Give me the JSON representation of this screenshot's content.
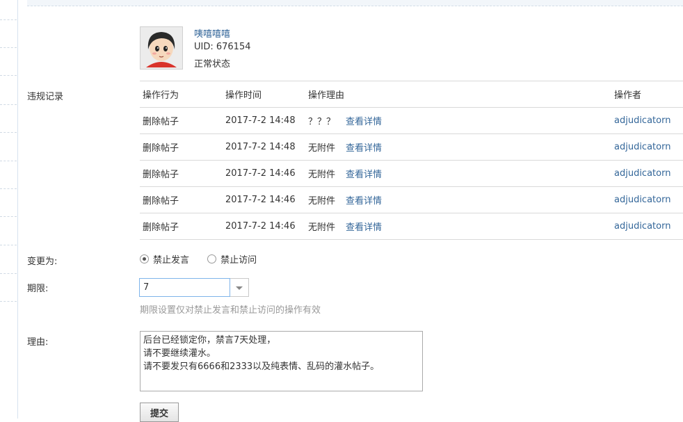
{
  "user": {
    "name": "咦嘻嘻嘻",
    "uid": "UID: 676154",
    "status": "正常状态"
  },
  "labels": {
    "records": "违规记录",
    "change_to": "变更为:",
    "period": "期限:",
    "reason": "理由:"
  },
  "records": {
    "headers": [
      "操作行为",
      "操作时间",
      "操作理由",
      "操作者"
    ],
    "detail_label": "查看详情",
    "rows": [
      {
        "action": "删除帖子",
        "time": "2017-7-2 14:48",
        "reason": "？？？",
        "operator": "adjudicatorn"
      },
      {
        "action": "删除帖子",
        "time": "2017-7-2 14:48",
        "reason": "无附件",
        "operator": "adjudicatorn"
      },
      {
        "action": "删除帖子",
        "time": "2017-7-2 14:46",
        "reason": "无附件",
        "operator": "adjudicatorn"
      },
      {
        "action": "删除帖子",
        "time": "2017-7-2 14:46",
        "reason": "无附件",
        "operator": "adjudicatorn"
      },
      {
        "action": "删除帖子",
        "time": "2017-7-2 14:46",
        "reason": "无附件",
        "operator": "adjudicatorn"
      }
    ]
  },
  "options": {
    "ban_post": "禁止发言",
    "ban_visit": "禁止访问"
  },
  "period": {
    "value": "7",
    "hint": "期限设置仅对禁止发言和禁止访问的操作有效"
  },
  "reason_text": "后台已经锁定你，禁言7天处理，\n请不要继续灌水。\n请不要发只有6666和2333以及纯表情、乱码的灌水帖子。",
  "submit_label": "提交"
}
